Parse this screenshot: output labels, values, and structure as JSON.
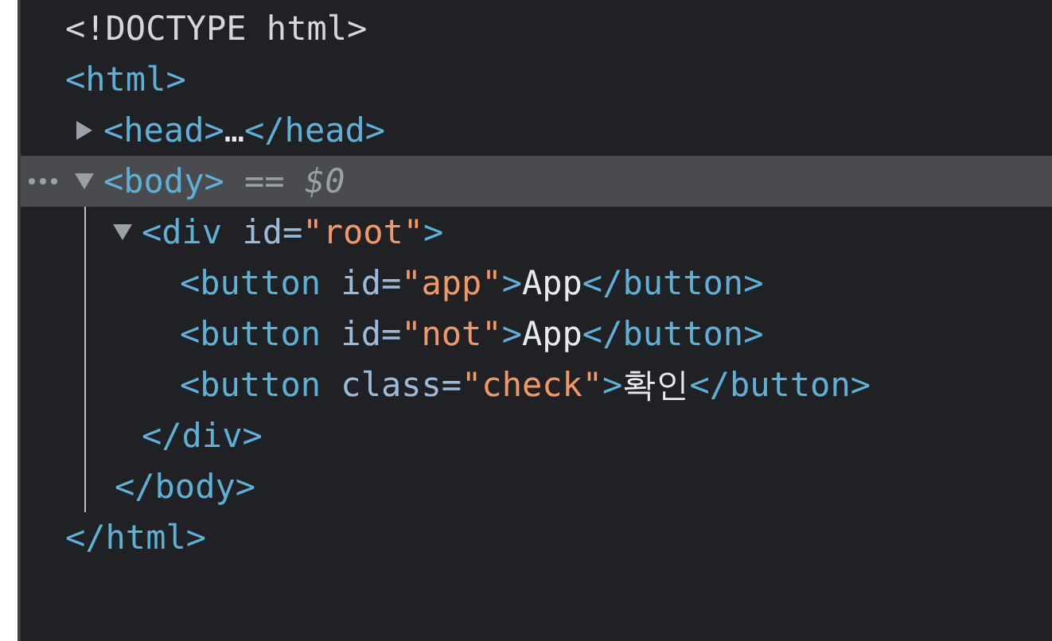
{
  "dom_tree": [
    {
      "kind": "doctype",
      "selected": false,
      "tokens": [
        {
          "kind": "doctype",
          "text": "<!DOCTYPE html>"
        }
      ]
    },
    {
      "kind": "element",
      "selected": false,
      "tokens": [
        {
          "kind": "tag",
          "text": "<html>"
        }
      ],
      "closing": [
        {
          "kind": "tag",
          "text": "</html>"
        }
      ],
      "children": [
        {
          "kind": "element",
          "selected": false,
          "expanded": false,
          "tokens": [
            {
              "kind": "tag",
              "text": "<head>"
            },
            {
              "kind": "text",
              "text": "…"
            },
            {
              "kind": "tag",
              "text": "</head>"
            }
          ]
        },
        {
          "kind": "element",
          "selected": true,
          "expanded": true,
          "tokens": [
            {
              "kind": "tag",
              "text": "<body>"
            },
            {
              "kind": "console_ref",
              "text": "== $0"
            }
          ],
          "closing": [
            {
              "kind": "tag",
              "text": "</body>"
            }
          ],
          "children": [
            {
              "kind": "element",
              "selected": false,
              "expanded": true,
              "tokens": [
                {
                  "kind": "tag",
                  "text": "<div"
                },
                {
                  "kind": "attr_name",
                  "text": "id="
                },
                {
                  "kind": "attr_value",
                  "text": "\"root\""
                },
                {
                  "kind": "tag",
                  "text": ">"
                }
              ],
              "closing": [
                {
                  "kind": "tag",
                  "text": "</div>"
                }
              ],
              "children": [
                {
                  "kind": "element",
                  "selected": false,
                  "tokens": [
                    {
                      "kind": "tag",
                      "text": "<button"
                    },
                    {
                      "kind": "attr_name",
                      "text": "id="
                    },
                    {
                      "kind": "attr_value",
                      "text": "\"app\""
                    },
                    {
                      "kind": "tag",
                      "text": ">"
                    },
                    {
                      "kind": "text",
                      "text": "App"
                    },
                    {
                      "kind": "tag",
                      "text": "</button>"
                    }
                  ]
                },
                {
                  "kind": "element",
                  "selected": false,
                  "tokens": [
                    {
                      "kind": "tag",
                      "text": "<button"
                    },
                    {
                      "kind": "attr_name",
                      "text": "id="
                    },
                    {
                      "kind": "attr_value",
                      "text": "\"not\""
                    },
                    {
                      "kind": "tag",
                      "text": ">"
                    },
                    {
                      "kind": "text",
                      "text": "App"
                    },
                    {
                      "kind": "tag",
                      "text": "</button>"
                    }
                  ]
                },
                {
                  "kind": "element",
                  "selected": false,
                  "tokens": [
                    {
                      "kind": "tag",
                      "text": "<button"
                    },
                    {
                      "kind": "attr_name",
                      "text": "class="
                    },
                    {
                      "kind": "attr_value",
                      "text": "\"check\""
                    },
                    {
                      "kind": "tag",
                      "text": ">"
                    },
                    {
                      "kind": "text",
                      "text": "확인"
                    },
                    {
                      "kind": "tag",
                      "text": "</button>"
                    }
                  ]
                }
              ]
            }
          ]
        }
      ]
    }
  ]
}
